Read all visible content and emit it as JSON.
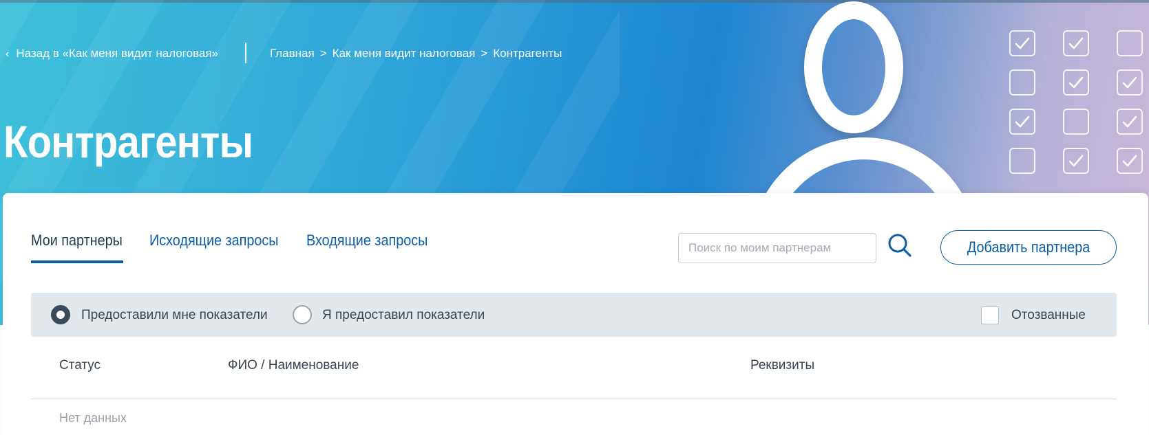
{
  "colors": {
    "accent": "#0c5ea8",
    "title_text": "#1f3a52",
    "filter_bg": "#e3e8ed",
    "hero_start": "#3ec1db",
    "hero_end": "#cbb8d8"
  },
  "icons": {
    "back": "chevron-left-icon",
    "search": "search-icon",
    "hero_art": "person-icon"
  },
  "header": {
    "back_link": "Назад в «Как меня видит налоговая»",
    "breadcrumb": {
      "separator": ">",
      "items": [
        "Главная",
        "Как меня видит налоговая",
        "Контрагенты"
      ]
    },
    "title": "Контрагенты"
  },
  "tabs": [
    {
      "label": "Мои партнеры",
      "active": true
    },
    {
      "label": "Исходящие запросы",
      "active": false
    },
    {
      "label": "Входящие запросы",
      "active": false
    }
  ],
  "search": {
    "placeholder": "Поиск по моим партнерам",
    "value": ""
  },
  "add_partner_button": "Добавить партнера",
  "filters": {
    "radio_options": [
      {
        "label": "Предоставили мне показатели",
        "selected": true
      },
      {
        "label": "Я предоставил показатели",
        "selected": false
      }
    ],
    "revoked_checkbox": {
      "label": "Отозванные",
      "checked": false
    }
  },
  "table": {
    "columns": [
      "Статус",
      "ФИО / Наименование",
      "Реквизиты"
    ],
    "rows": [],
    "empty_text": "Нет данных"
  }
}
